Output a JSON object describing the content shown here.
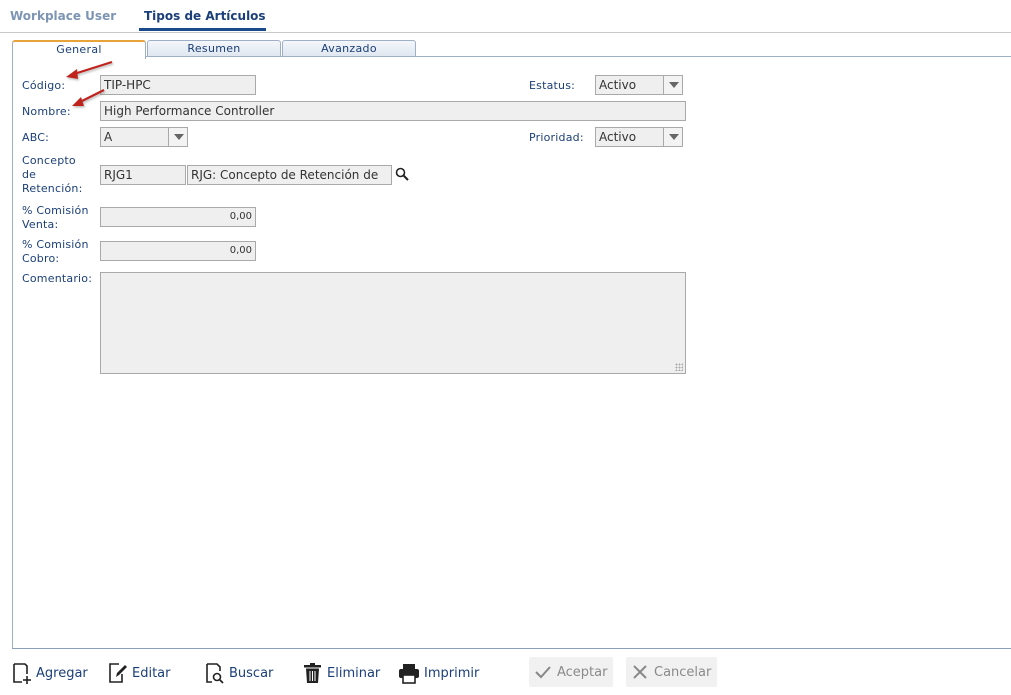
{
  "top_tabs": [
    {
      "label": "Workplace User",
      "active": false
    },
    {
      "label": "Tipos de Artículos",
      "active": true
    }
  ],
  "sub_tabs": [
    {
      "label": "General",
      "active": true
    },
    {
      "label": "Resumen",
      "active": false
    },
    {
      "label": "Avanzado",
      "active": false
    }
  ],
  "form": {
    "codigo_label": "Código:",
    "codigo_value": "TIP-HPC",
    "estatus_label": "Estatus:",
    "estatus_value": "Activo",
    "nombre_label": "Nombre:",
    "nombre_value": "High Performance Controller",
    "abc_label": "ABC:",
    "abc_value": "A",
    "prioridad_label": "Prioridad:",
    "prioridad_value": "Activo",
    "concepto_label_1": "Concepto",
    "concepto_label_2": "de",
    "concepto_label_3": "Retención:",
    "concepto_code": "RJG1",
    "concepto_desc": "RJG: Concepto de Retención de",
    "comision_venta_label_1": "% Comisión",
    "comision_venta_label_2": "Venta:",
    "comision_venta_value": "0,00",
    "comision_cobro_label_1": "% Comisión",
    "comision_cobro_label_2": "Cobro:",
    "comision_cobro_value": "0,00",
    "comentario_label": "Comentario:",
    "comentario_value": ""
  },
  "toolbar": {
    "agregar": "Agregar",
    "editar": "Editar",
    "buscar": "Buscar",
    "eliminar": "Eliminar",
    "imprimir": "Imprimir",
    "aceptar": "Aceptar",
    "cancelar": "Cancelar"
  },
  "colors": {
    "accent": "#1b3f78",
    "active_tab_border": "#e8a33a",
    "annotation_arrow": "#c0231d"
  }
}
